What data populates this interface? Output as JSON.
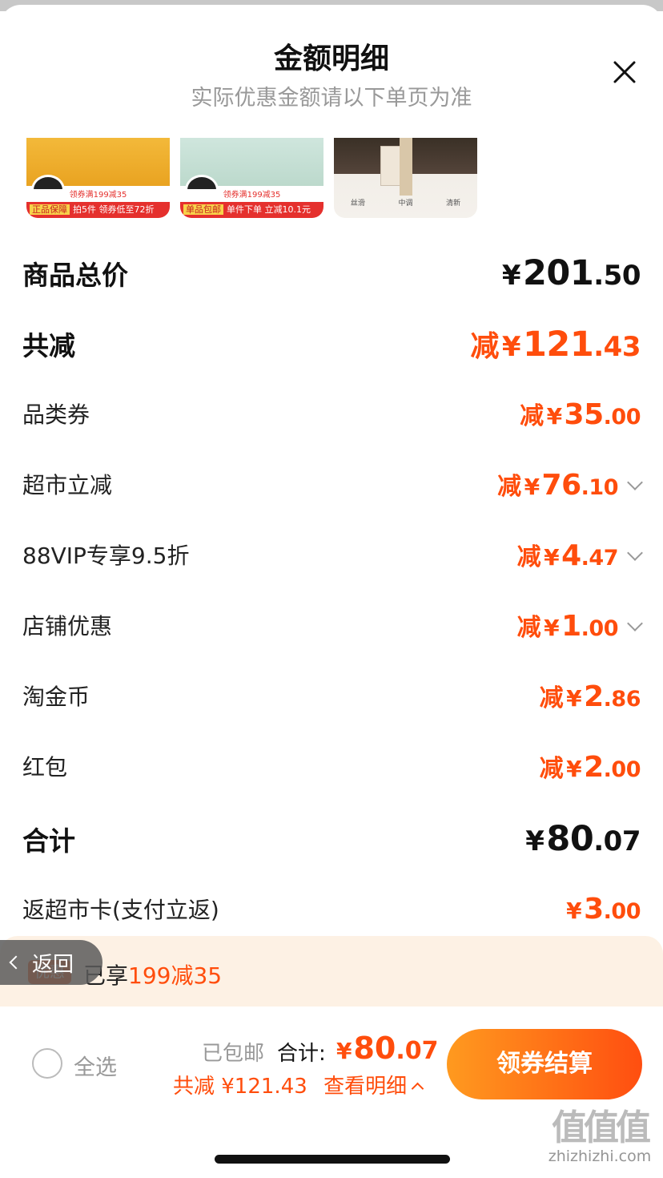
{
  "header": {
    "title": "金额明细",
    "subtitle": "实际优惠金额请以下单页为准"
  },
  "thumbnails": [
    {
      "banner": "领券满199减35",
      "tag": "正品保障",
      "promo": "拍5件 领券低至72折"
    },
    {
      "banner": "领券满199减35",
      "tag": "单品包邮",
      "promo": "单件下单 立减10.1元"
    },
    {
      "labels": [
        "丝滑",
        "中调",
        "清新"
      ]
    }
  ],
  "summary": {
    "goods_total": {
      "label": "商品总价",
      "yen": "¥",
      "int": "201",
      "dec": ".50"
    },
    "total_reduce": {
      "label": "共减",
      "prefix": "减",
      "yen": "¥",
      "int": "121",
      "dec": ".43"
    }
  },
  "discounts": [
    {
      "label": "品类券",
      "prefix": "减",
      "yen": "¥",
      "int": "35",
      "dec": ".00",
      "expandable": false
    },
    {
      "label": "超市立减",
      "prefix": "减",
      "yen": "¥",
      "int": "76",
      "dec": ".10",
      "expandable": true
    },
    {
      "label": "88VIP专享9.5折",
      "prefix": "减",
      "yen": "¥",
      "int": "4",
      "dec": ".47",
      "expandable": true
    },
    {
      "label": "店铺优惠",
      "prefix": "减",
      "yen": "¥",
      "int": "1",
      "dec": ".00",
      "expandable": true
    },
    {
      "label": "淘金币",
      "prefix": "减",
      "yen": "¥",
      "int": "2",
      "dec": ".86",
      "expandable": false
    },
    {
      "label": "红包",
      "prefix": "减",
      "yen": "¥",
      "int": "2",
      "dec": ".00",
      "expandable": false
    }
  ],
  "total": {
    "label": "合计",
    "yen": "¥",
    "int": "80",
    "dec": ".07"
  },
  "cashback": {
    "label": "返超市卡(支付立返)",
    "yen": "¥",
    "int": "3",
    "dec": ".00"
  },
  "promo_bar": {
    "badge": "优惠",
    "text_prefix": "已享",
    "text_highlight": "199减35"
  },
  "back_button": {
    "label": "返回"
  },
  "footer": {
    "select_all": "全选",
    "shipping": "已包邮",
    "total_label": "合计:",
    "total_yen": "¥",
    "total_int": "80",
    "total_dec": ".07",
    "reduce_text": "共减 ¥121.43",
    "details_link": "查看明细",
    "checkout_button": "领券结算"
  },
  "watermark": {
    "logo": "值值值",
    "site": "zhizhizhi.com"
  },
  "colors": {
    "accent": "#ff4d0c",
    "checkout_from": "#ff9a1f",
    "checkout_to": "#ff4e10",
    "promo_bg": "#fdf1e4"
  }
}
